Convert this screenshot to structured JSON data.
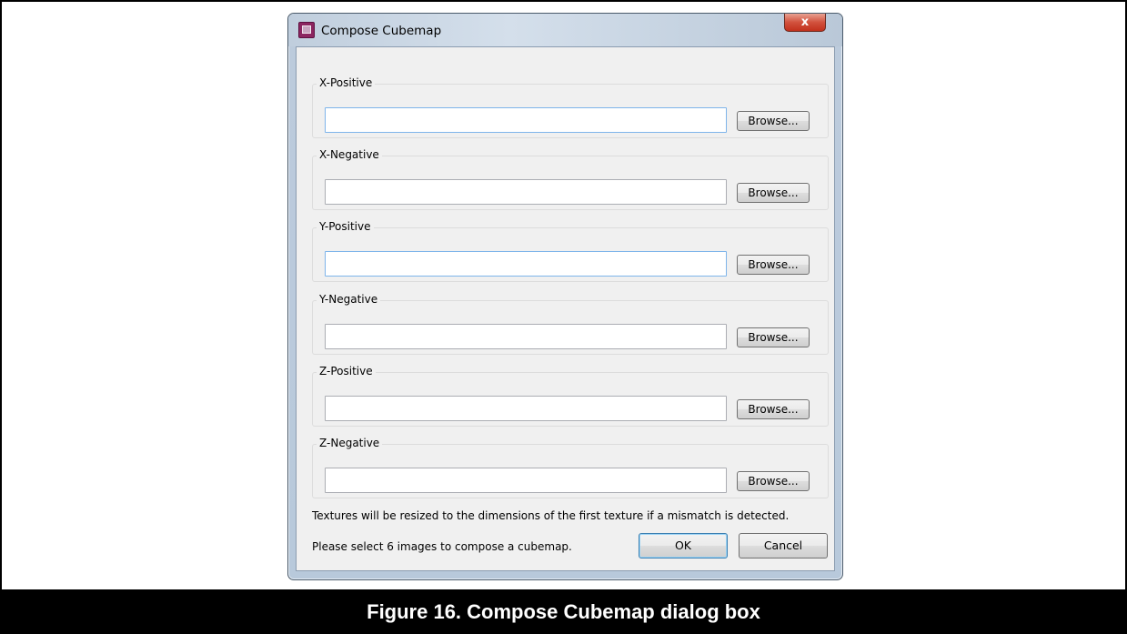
{
  "window": {
    "title": "Compose Cubemap",
    "close_glyph": "x",
    "icon": "app-icon"
  },
  "groups": [
    {
      "label": "X-Positive",
      "value": "",
      "browse_label": "Browse..."
    },
    {
      "label": "X-Negative",
      "value": "",
      "browse_label": "Browse..."
    },
    {
      "label": "Y-Positive",
      "value": "",
      "browse_label": "Browse..."
    },
    {
      "label": "Y-Negative",
      "value": "",
      "browse_label": "Browse..."
    },
    {
      "label": "Z-Positive",
      "value": "",
      "browse_label": "Browse..."
    },
    {
      "label": "Z-Negative",
      "value": "",
      "browse_label": "Browse..."
    }
  ],
  "notes": {
    "resize": "Textures will be resized to the dimensions of the first texture if a mismatch is detected.",
    "status": "Please select 6 images to compose a cubemap."
  },
  "buttons": {
    "ok": "OK",
    "cancel": "Cancel"
  },
  "caption": "Figure 16. Compose Cubemap dialog box",
  "colors": {
    "caption_bg": "#000000",
    "caption_text": "#ffffff",
    "close_button": "#c1301c"
  }
}
